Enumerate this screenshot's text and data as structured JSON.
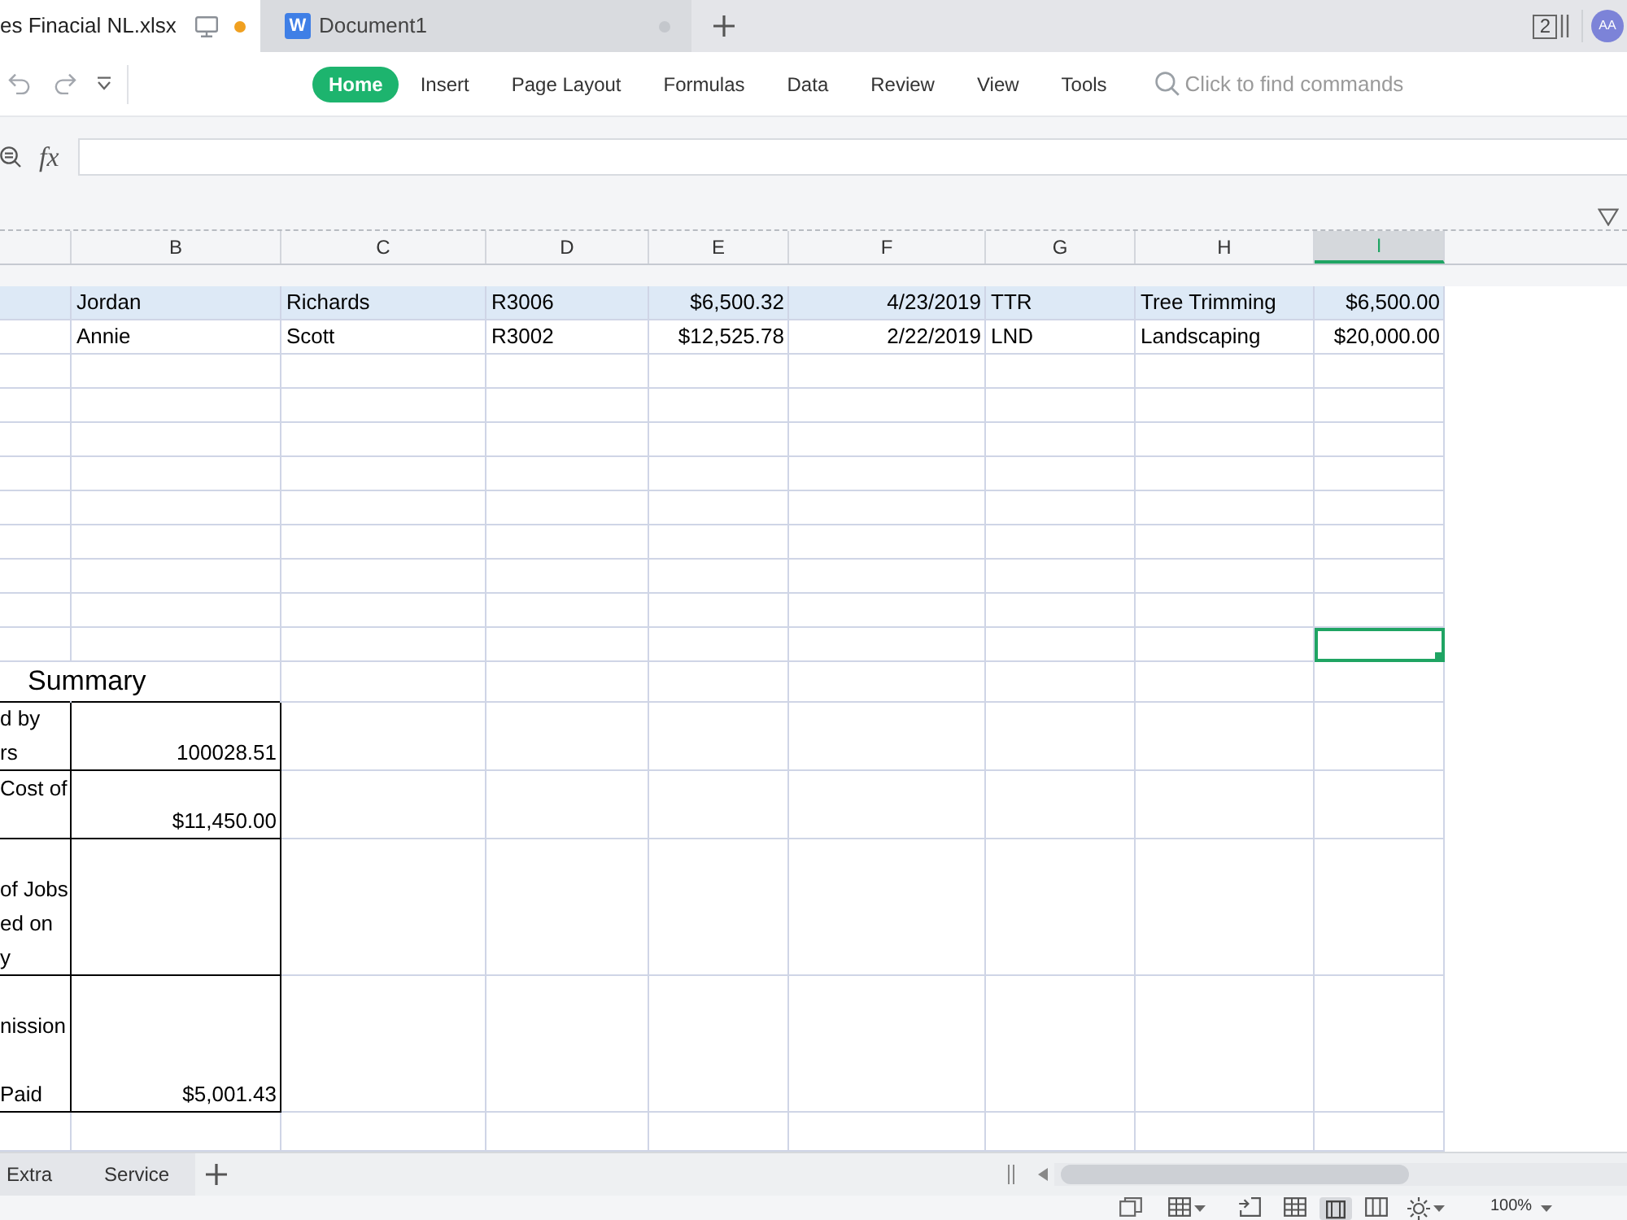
{
  "title_bar": {
    "tabs": [
      {
        "kind": "sheet",
        "title": "es Finacial NL.xlsx",
        "selected": true,
        "modified": true
      },
      {
        "kind": "writer",
        "logo": "W",
        "title": "Document1",
        "selected": false,
        "modified": false
      }
    ],
    "window_count": "2",
    "avatar": "AA"
  },
  "toolbar": {
    "ribbon_tabs": [
      {
        "label": "Home",
        "selected": true
      },
      {
        "label": "Insert",
        "selected": false
      },
      {
        "label": "Page Layout",
        "selected": false
      },
      {
        "label": "Formulas",
        "selected": false
      },
      {
        "label": "Data",
        "selected": false
      },
      {
        "label": "Review",
        "selected": false
      },
      {
        "label": "View",
        "selected": false
      },
      {
        "label": "Tools",
        "selected": false
      }
    ],
    "search": {
      "placeholder": "Click to find commands"
    }
  },
  "formula_bar": {
    "function_label": "fx"
  },
  "sheet": {
    "columns": [
      {
        "label": "B",
        "selected": false
      },
      {
        "label": "C",
        "selected": false
      },
      {
        "label": "D",
        "selected": false
      },
      {
        "label": "E",
        "selected": false
      },
      {
        "label": "F",
        "selected": false
      },
      {
        "label": "G",
        "selected": false
      },
      {
        "label": "H",
        "selected": false
      },
      {
        "label": "I",
        "selected": true
      }
    ],
    "rows": [
      {
        "shaded": true,
        "active": false,
        "cells": [
          "Jordan",
          "Richards",
          "R3006",
          "$6,500.32",
          "4/23/2019",
          "TTR",
          "Tree Trimming",
          "$6,500.00"
        ]
      },
      {
        "shaded": false,
        "active": false,
        "cells": [
          "Annie",
          "Scott",
          "R3002",
          "$12,525.78",
          "2/22/2019",
          "LND",
          "Landscaping",
          "$20,000.00"
        ]
      },
      {
        "shaded": false,
        "active": false
      },
      {
        "shaded": false,
        "active": false
      },
      {
        "shaded": false,
        "active": false
      },
      {
        "shaded": false,
        "active": false
      },
      {
        "shaded": false,
        "active": false
      },
      {
        "shaded": false,
        "active": false
      },
      {
        "shaded": false,
        "active": false
      },
      {
        "shaded": false,
        "active": false
      },
      {
        "shaded": false,
        "active": true
      }
    ],
    "summary": {
      "title": "Summary",
      "items": [
        {
          "label": "d by\nrs",
          "value": "100028.51"
        },
        {
          "label": "Cost of",
          "value": "$11,450.00"
        },
        {
          "label": "of Jobs\ned on\ny"
        },
        {
          "label": "nission\n\nPaid",
          "value": "$5,001.43"
        }
      ]
    }
  },
  "sheet_tabs": [
    {
      "label": "Extra",
      "selected": false
    },
    {
      "label": "Service",
      "selected": false
    }
  ],
  "status_bar": {
    "zoom": "100%"
  }
}
